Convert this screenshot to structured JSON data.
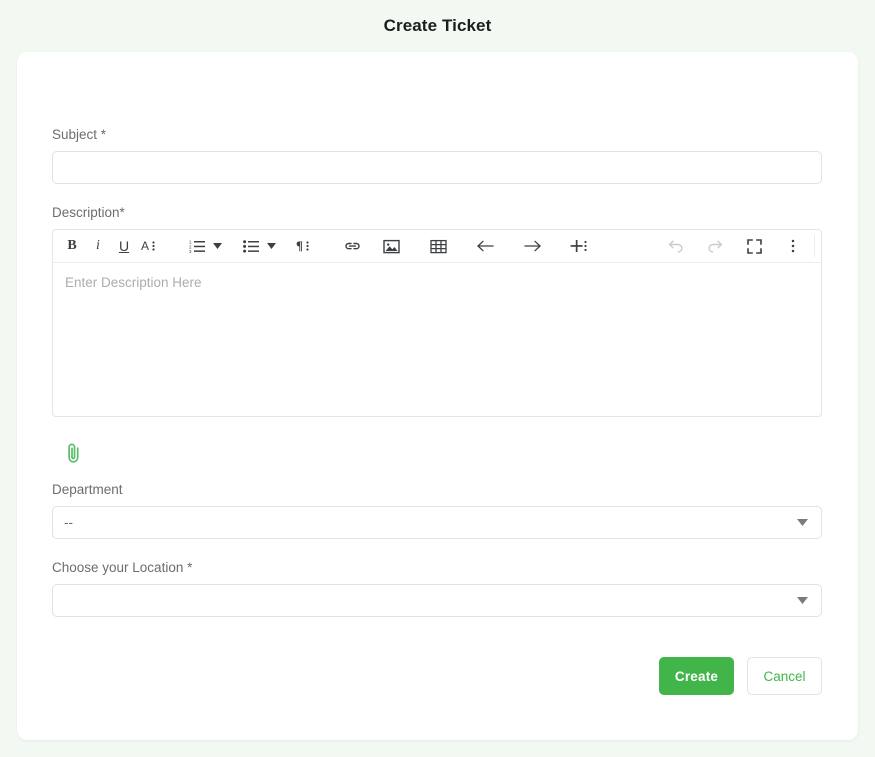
{
  "page": {
    "title": "Create Ticket",
    "background_color": "#f2f8f2",
    "card_color": "#ffffff",
    "accent_color": "#41b549"
  },
  "form": {
    "subject": {
      "label": "Subject *",
      "value": "",
      "placeholder": ""
    },
    "description": {
      "label": "Description*",
      "placeholder": "Enter Description Here",
      "value": ""
    },
    "attachment": {
      "icon": "paperclip-icon",
      "color": "#5bbd6a"
    },
    "department": {
      "label": "Department",
      "value": "--",
      "options": [
        "--"
      ]
    },
    "location": {
      "label": "Choose your Location *",
      "value": "",
      "options": []
    }
  },
  "editor_toolbar": {
    "buttons": [
      {
        "name": "bold-icon",
        "glyph": "B",
        "label": "Bold",
        "disabled": false
      },
      {
        "name": "italic-icon",
        "glyph": "i",
        "label": "Italic",
        "disabled": false
      },
      {
        "name": "underline-icon",
        "glyph": "U",
        "label": "Underline",
        "disabled": false
      },
      {
        "name": "font-style-icon",
        "glyph": "A",
        "label": "Font Style",
        "disabled": false
      },
      {
        "name": "ordered-list-icon",
        "glyph": "1.",
        "label": "Ordered List",
        "disabled": false
      },
      {
        "name": "ordered-list-dropdown-icon",
        "glyph": "▾",
        "label": "Ordered List Options",
        "disabled": false
      },
      {
        "name": "unordered-list-icon",
        "glyph": "•",
        "label": "Unordered List",
        "disabled": false
      },
      {
        "name": "unordered-list-dropdown-icon",
        "glyph": "▾",
        "label": "Unordered List Options",
        "disabled": false
      },
      {
        "name": "paragraph-format-icon",
        "glyph": "¶",
        "label": "Paragraph Format",
        "disabled": false
      },
      {
        "name": "link-icon",
        "glyph": "🔗",
        "label": "Insert Link",
        "disabled": false
      },
      {
        "name": "image-icon",
        "glyph": "🖼",
        "label": "Insert Image",
        "disabled": false
      },
      {
        "name": "table-icon",
        "glyph": "▦",
        "label": "Insert Table",
        "disabled": false
      },
      {
        "name": "outdent-icon",
        "glyph": "←",
        "label": "Outdent",
        "disabled": false
      },
      {
        "name": "indent-icon",
        "glyph": "→",
        "label": "Indent",
        "disabled": false
      },
      {
        "name": "insert-more-icon",
        "glyph": "+",
        "label": "Insert More",
        "disabled": false
      },
      {
        "name": "undo-icon",
        "glyph": "↺",
        "label": "Undo",
        "disabled": true
      },
      {
        "name": "redo-icon",
        "glyph": "↻",
        "label": "Redo",
        "disabled": true
      },
      {
        "name": "fullscreen-icon",
        "glyph": "⛶",
        "label": "Fullscreen",
        "disabled": false
      },
      {
        "name": "more-options-icon",
        "glyph": "⋮",
        "label": "More Options",
        "disabled": false
      }
    ]
  },
  "actions": {
    "create_label": "Create",
    "cancel_label": "Cancel"
  }
}
